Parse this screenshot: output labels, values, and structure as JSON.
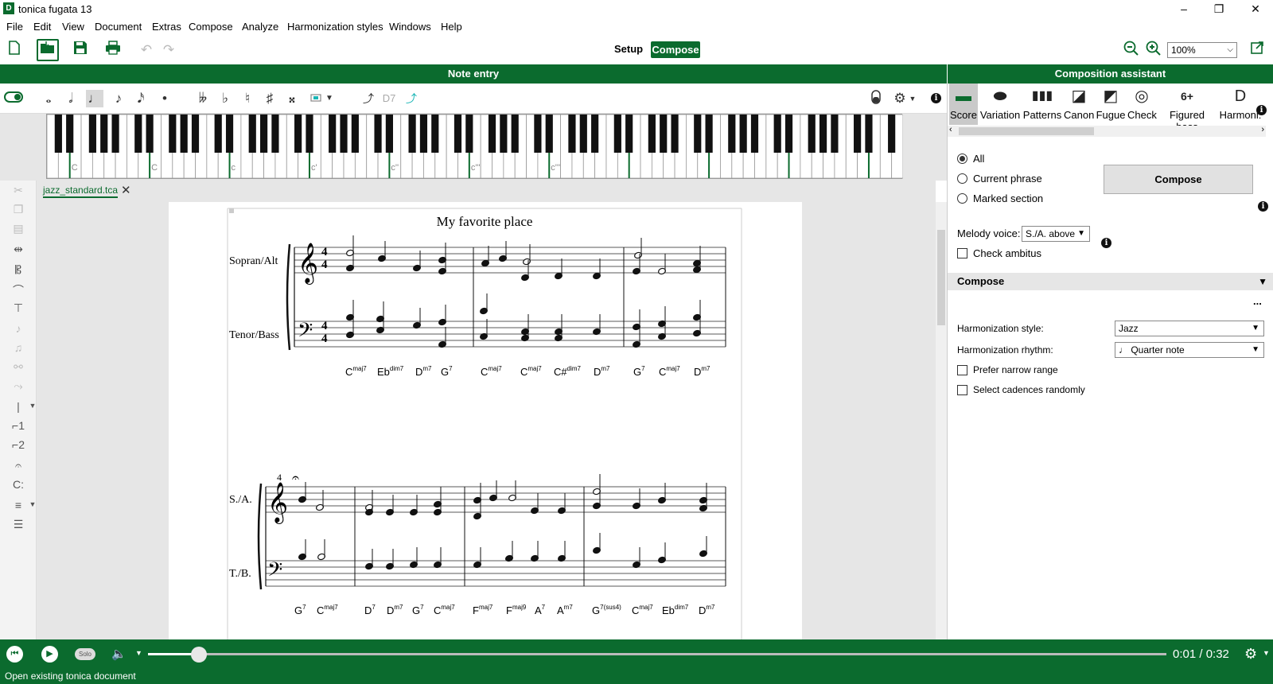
{
  "window": {
    "title": "tonica fugata 13",
    "logo": "D",
    "min": "–",
    "max": "❐",
    "close": "✕"
  },
  "menu": [
    "File",
    "Edit",
    "View",
    "Document",
    "Extras",
    "Compose",
    "Analyze",
    "Harmonization styles",
    "Windows",
    "Help"
  ],
  "toolbar": {
    "setup_label": "Setup",
    "compose_label": "Compose",
    "zoom": "100%"
  },
  "panels": {
    "note_entry": "Note entry",
    "assistant": "Composition assistant"
  },
  "note_toolbar": {
    "durations": [
      "𝅝",
      "𝅗𝅥",
      "♩",
      "♪",
      "𝅘𝅥𝅯",
      "•"
    ],
    "accidentals": [
      "𝄫",
      "♭",
      "♮",
      "♯",
      "𝄪"
    ],
    "chord_labels": [
      "D7"
    ]
  },
  "piano": {
    "c_labels": [
      "C",
      "C",
      "c",
      "c'",
      "c''",
      "c'''",
      "c''''"
    ]
  },
  "document": {
    "tab_name": "jazz_standard.tca",
    "title": "My favorite place",
    "system1": {
      "staff_upper": "Sopran/Alt",
      "staff_lower": "Tenor/Bass",
      "chords": [
        {
          "root": "C",
          "ext": "maj7"
        },
        {
          "root": "Eb",
          "ext": "dim7"
        },
        {
          "root": "D",
          "ext": "m7"
        },
        {
          "root": "G",
          "ext": "7"
        },
        {
          "root": "C",
          "ext": "maj7"
        },
        {
          "root": "C",
          "ext": "maj7"
        },
        {
          "root": "C#",
          "ext": "dim7"
        },
        {
          "root": "D",
          "ext": "m7"
        },
        {
          "root": "G",
          "ext": "7"
        },
        {
          "root": "C",
          "ext": "maj7"
        },
        {
          "root": "D",
          "ext": "m7"
        }
      ]
    },
    "system2": {
      "measure_number": "4",
      "staff_upper": "S./A.",
      "staff_lower": "T./B.",
      "chords": [
        {
          "root": "G",
          "ext": "7"
        },
        {
          "root": "C",
          "ext": "maj7"
        },
        {
          "root": "D",
          "ext": "7"
        },
        {
          "root": "D",
          "ext": "m7"
        },
        {
          "root": "G",
          "ext": "7"
        },
        {
          "root": "C",
          "ext": "maj7"
        },
        {
          "root": "F",
          "ext": "maj7"
        },
        {
          "root": "F",
          "ext": "maj9"
        },
        {
          "root": "A",
          "ext": "7"
        },
        {
          "root": "A",
          "ext": "m7"
        },
        {
          "root": "G",
          "ext": "7(sus4)"
        },
        {
          "root": "C",
          "ext": "maj7"
        },
        {
          "root": "Eb",
          "ext": "dim7"
        },
        {
          "root": "D",
          "ext": "m7"
        }
      ]
    }
  },
  "assistant": {
    "tabs": [
      {
        "label": "Score",
        "icon": "score-icon",
        "glyph": "▬"
      },
      {
        "label": "Variation",
        "icon": "variation-icon",
        "glyph": "⬬"
      },
      {
        "label": "Patterns",
        "icon": "patterns-icon",
        "glyph": "▮▮▮"
      },
      {
        "label": "Canon",
        "icon": "canon-icon",
        "glyph": "◪"
      },
      {
        "label": "Fugue",
        "icon": "fugue-icon",
        "glyph": "◩"
      },
      {
        "label": "Check",
        "icon": "check-icon",
        "glyph": "◎"
      },
      {
        "label": "Figured bass",
        "icon": "figured-bass-icon",
        "glyph": "6+"
      },
      {
        "label": "Harmoni:",
        "icon": "harmonization-icon",
        "glyph": "D"
      }
    ],
    "scope_options": [
      "All",
      "Current phrase",
      "Marked section"
    ],
    "compose_button": "Compose",
    "melody_voice_label": "Melody voice:",
    "melody_voice_value": "S./A. above",
    "check_ambitus": "Check ambitus",
    "section_title": "Compose",
    "more": "...",
    "style_label": "Harmonization style:",
    "style_value": "Jazz",
    "rhythm_label": "Harmonization rhythm:",
    "rhythm_value": "♩ Quarter note",
    "prefer_narrow": "Prefer narrow range",
    "select_cadences": "Select cadences randomly"
  },
  "player": {
    "solo_label": "Solo",
    "time": "0:01 / 0:32",
    "progress": 0.05
  },
  "status": "Open existing tonica document",
  "colors": {
    "brand": "#0b6b2e",
    "teal": "#19b5b5"
  }
}
